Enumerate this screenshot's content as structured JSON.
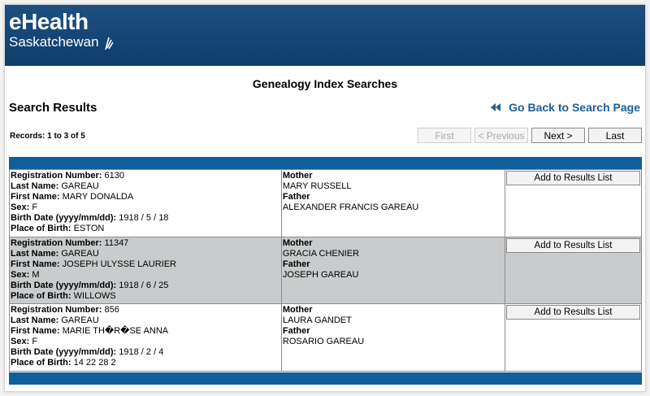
{
  "brand": {
    "name": "eHealth",
    "sub": "Saskatchewan"
  },
  "page_title": "Genealogy Index Searches",
  "results_title": "Search Results",
  "back_link": "Go Back to Search Page",
  "records_text": "Records: 1 to 3 of 5",
  "pager": {
    "first": "First",
    "previous": "< Previous",
    "next": "Next >",
    "last": "Last"
  },
  "labels": {
    "registration_number": "Registration Number:",
    "last_name": "Last Name:",
    "first_name": "First Name:",
    "sex": "Sex:",
    "birth_date": "Birth Date (yyyy/mm/dd):",
    "place_of_birth": "Place of Birth:",
    "mother": "Mother",
    "father": "Father",
    "add_button": "Add to Results List"
  },
  "results": [
    {
      "registration_number": "6130",
      "last_name": "GAREAU",
      "first_name": "MARY DONALDA",
      "sex": "F",
      "birth_date": "1918 / 5 / 18",
      "place_of_birth": "ESTON",
      "mother": "MARY RUSSELL",
      "father": "ALEXANDER FRANCIS GAREAU"
    },
    {
      "registration_number": "11347",
      "last_name": "GAREAU",
      "first_name": "JOSEPH ULYSSE LAURIER",
      "sex": "M",
      "birth_date": "1918 / 6 / 25",
      "place_of_birth": "WILLOWS",
      "mother": "GRACIA CHENIER",
      "father": "JOSEPH GAREAU"
    },
    {
      "registration_number": "856",
      "last_name": "GAREAU",
      "first_name": "MARIE TH�R�SE ANNA",
      "sex": "F",
      "birth_date": "1918 / 2 / 4",
      "place_of_birth": "14 22 28 2",
      "mother": "LAURA GANDET",
      "father": "ROSARIO GAREAU"
    }
  ],
  "colors": {
    "banner": "#0f3d6b",
    "bar": "#0f5f9b",
    "link": "#1b5f9a",
    "alt_row": "#c9cbcc"
  },
  "icons": {
    "back": "double-left-arrow-icon",
    "logo": "wheat-logo-icon"
  }
}
